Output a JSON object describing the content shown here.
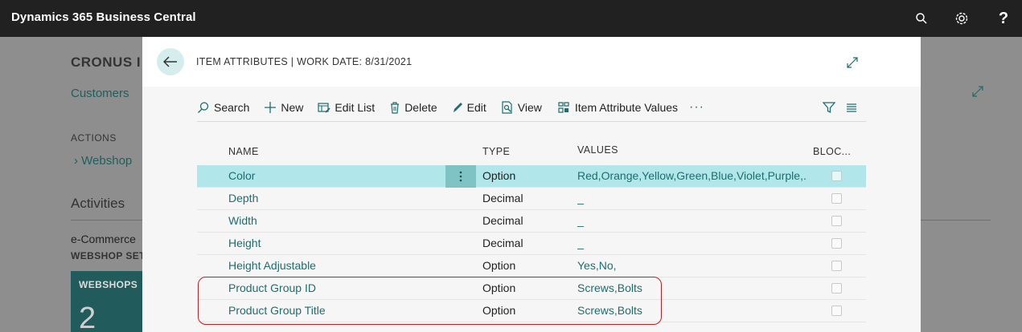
{
  "app": {
    "title": "Dynamics 365 Business Central",
    "icons": [
      "search-icon",
      "gear-icon",
      "help-icon"
    ]
  },
  "background": {
    "company": "CRONUS I",
    "customers_link": "Customers",
    "actions_heading": "ACTIONS",
    "webshop_link": "Webshop",
    "activities_heading": "Activities",
    "ecommerce_label": "e-Commerce",
    "webshop_setup_label": "WEBSHOP SET",
    "tile": {
      "label": "WEBSHOPS",
      "value": "2",
      "color": "#215b5b"
    }
  },
  "dialog": {
    "title": "ITEM ATTRIBUTES | WORK DATE: 8/31/2021",
    "toolbar": {
      "search": "Search",
      "new": "New",
      "edit_list": "Edit List",
      "delete": "Delete",
      "edit": "Edit",
      "view": "View",
      "item_attribute_values": "Item Attribute Values",
      "more": "···"
    },
    "columns": {
      "name": "NAME",
      "type": "TYPE",
      "values": "VALUES",
      "blocked": "BLOC..."
    },
    "rows": [
      {
        "name": "Color",
        "type": "Option",
        "values": "Red,Orange,Yellow,Green,Blue,Violet,Purple,...",
        "selected": true
      },
      {
        "name": "Depth",
        "type": "Decimal",
        "values": "_"
      },
      {
        "name": "Width",
        "type": "Decimal",
        "values": "_"
      },
      {
        "name": "Height",
        "type": "Decimal",
        "values": "_"
      },
      {
        "name": "Height Adjustable",
        "type": "Option",
        "values": "Yes,No,"
      },
      {
        "name": "Product Group ID",
        "type": "Option",
        "values": "Screws,Bolts"
      },
      {
        "name": "Product Group Title",
        "type": "Option",
        "values": "Screws,Bolts"
      }
    ]
  },
  "colors": {
    "topbar": "#212121",
    "accent": "#1b6f6f",
    "selected_row": "#b1e7ea",
    "highlight_border": "#c81e1e"
  }
}
